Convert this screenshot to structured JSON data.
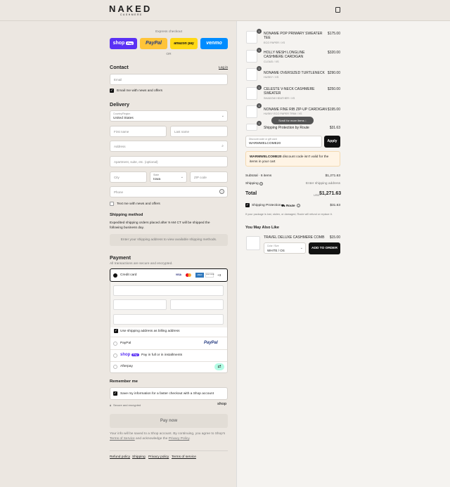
{
  "header": {
    "brand": "NAKED",
    "brand_sub": "CASHMERE",
    "bag_icon": "bag-icon"
  },
  "express": {
    "title": "Express checkout",
    "shop": "shop",
    "shop_pay": "Pay",
    "paypal": "PayPal",
    "amazon": "amazon pay",
    "venmo": "venmo",
    "or": "OR"
  },
  "contact": {
    "title": "Contact",
    "login": "Log in",
    "email_placeholder": "Email",
    "newsletter": "Email me with news and offers"
  },
  "delivery": {
    "title": "Delivery",
    "country_label": "Country/Region",
    "country": "United States",
    "first_name": "First name",
    "last_name": "Last name",
    "address": "Address",
    "apartment": "Apartment, suite, etc. (optional)",
    "city": "City",
    "state_label": "State",
    "state": "Iowa",
    "zip": "ZIP code",
    "phone": "Phone",
    "sms": "Text me with news and offers"
  },
  "shipping": {
    "title": "Shipping method",
    "note": "Expedited shipping orders placed after 9 AM CT will be shipped the following business day.",
    "placeholder": "Enter your shipping address to view available shipping methods."
  },
  "payment": {
    "title": "Payment",
    "subtitle": "All transactions are secure and encrypted.",
    "credit_card": "Credit card",
    "cards": [
      "VISA",
      "MC",
      "AMEX",
      "DISCOVER"
    ],
    "more": "+3",
    "billing": "Use shipping address as billing address",
    "paypal": "PayPal",
    "paypal_logo": "PayPal",
    "shoppay_text": "Pay in full or in installments",
    "shoppay_logo": "shop",
    "shoppay_badge": "Pay",
    "afterpay": "Afterpay"
  },
  "remember": {
    "title": "Remember me",
    "save": "Save my information for a faster checkout with a Shop account",
    "secure": "Secure and encrypted",
    "shop": "shop"
  },
  "pay_button": "Pay now",
  "legal": {
    "text_before": "Your info will be saved to a Shop account. By continuing, you agree to Shop's ",
    "terms": "Terms of Service",
    "text_mid": " and acknowledge the ",
    "privacy": "Privacy Policy",
    "text_after": "."
  },
  "footer_links": [
    "Refund policy",
    "Shipping",
    "Privacy policy",
    "Terms of service"
  ],
  "cart": {
    "items": [
      {
        "qty": "1",
        "name": "NONAME POP PRIMARY SWEATER TEE",
        "variant": "ECO PAPER / XS",
        "price": "$175.00"
      },
      {
        "qty": "1",
        "name": "HOLLY MESH LONGLINE CASHMERE CARDIGAN",
        "variant": "CLOUD / XS",
        "price": "$320.00"
      },
      {
        "qty": "1",
        "name": "NONAME OVERSIZED TURTLENECK",
        "variant": "HUSKY / XS",
        "price": "$290.00"
      },
      {
        "qty": "1",
        "name": "CELESTE V-NECK CASHMERE SWEATER",
        "variant": "SHADOW HEATHER / XS",
        "price": "$250.00"
      },
      {
        "qty": "1",
        "name": "NONAME FINE RIB ZIP-UP CARDIGAN",
        "variant": "HUSKY ECO PAPER TRIM / XS",
        "price": "$195.00"
      },
      {
        "qty": "1",
        "name": "Shipping Protection by Route",
        "variant": "",
        "price": "$31.63"
      }
    ],
    "scroll_hint": "Scroll for more items",
    "discount_label": "Discount code or gift card",
    "discount_value": "WARMWELCOME20",
    "apply": "Apply",
    "discount_error_code": "WARMWELCOME20",
    "discount_error": " discount code isn't valid for the items in your cart",
    "subtotal_label": "Subtotal · 6 items",
    "subtotal": "$1,271.63",
    "shipping_label": "Shipping",
    "shipping_value": "Enter shipping address",
    "total_label": "Total",
    "currency": "USD",
    "total": "$1,271.63",
    "route_label": "Shipping Protection",
    "route_brand": "Route",
    "route_price": "$31.63",
    "route_note": "If your package is lost, stolen, or damaged, Route will refund or replace it."
  },
  "upsell": {
    "title": "You May Also Like",
    "name": "TRAVEL DELUXE CASHMERE COMB",
    "price": "$15.00",
    "color_label": "Color / Size",
    "color": "WHITE / OS",
    "add": "ADD TO ORDER"
  }
}
